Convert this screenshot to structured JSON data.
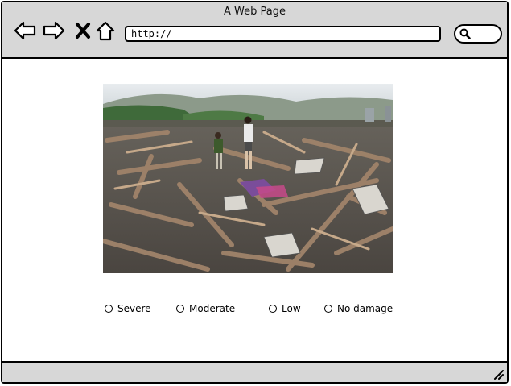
{
  "window": {
    "title": "A Web Page"
  },
  "toolbar": {
    "back_icon": "back-arrow-icon",
    "forward_icon": "forward-arrow-icon",
    "stop_icon": "close-x-icon",
    "home_icon": "home-icon",
    "url_value": "http://",
    "search_icon": "search-icon"
  },
  "main": {
    "image_icon": "photo-of-collapsed-wooden-buildings-rubble",
    "options": [
      {
        "label": "Severe"
      },
      {
        "label": "Moderate"
      },
      {
        "label": "Low"
      },
      {
        "label": "No damage"
      }
    ]
  },
  "colors": {
    "chrome": "#d7d7d7",
    "border": "#000000",
    "background": "#ffffff"
  }
}
